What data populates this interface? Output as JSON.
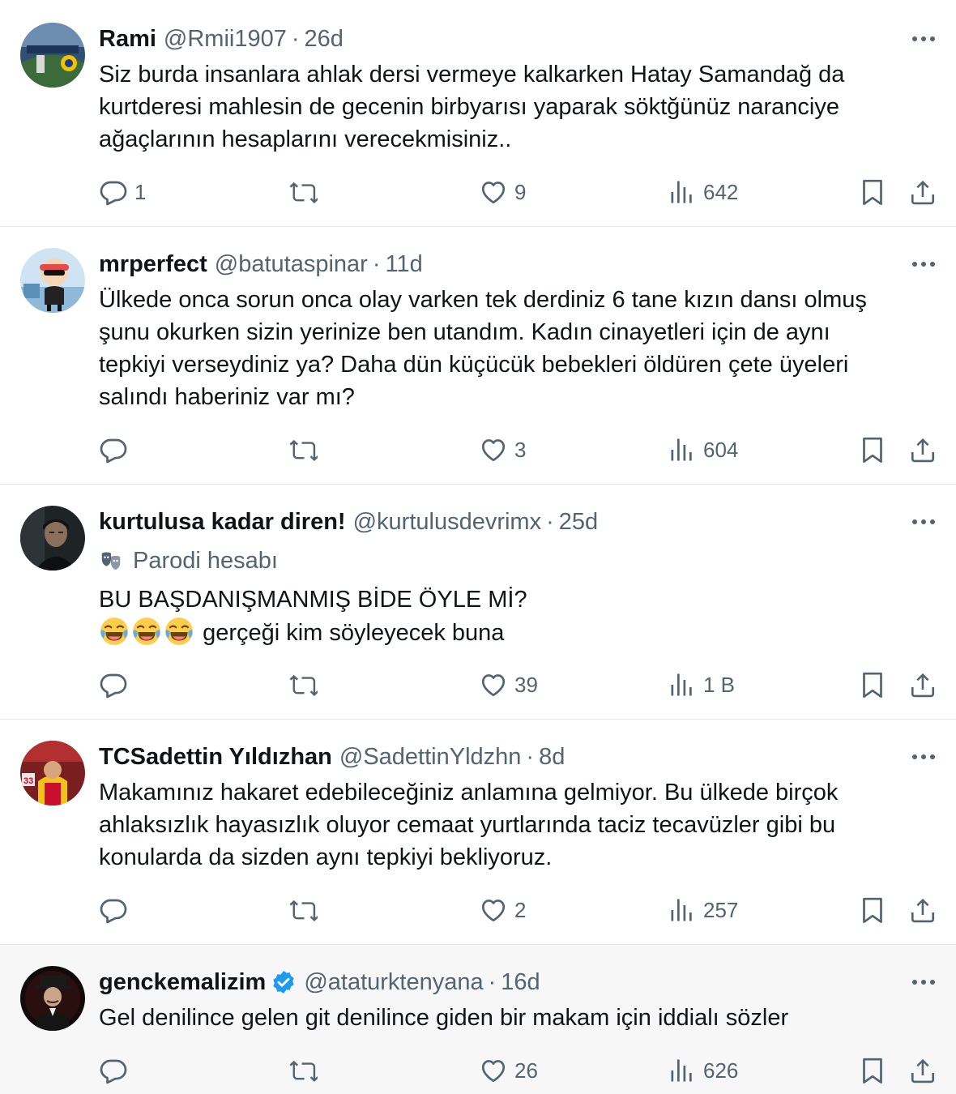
{
  "tweets": [
    {
      "name": "Rami",
      "handle": "@Rmii1907",
      "time": "26d",
      "text": [
        "Siz burda insanlara ahlak dersi vermeye kalkarken Hatay Samandağ da",
        "kurtderesi mahlesin de gecenin birbyarısı yaparak söktğünüz naranciye",
        "ağaçlarının hesaplarını verecekmisiniz.."
      ],
      "replies": "1",
      "reposts": "",
      "likes": "9",
      "views": "642",
      "avatar": "stadium"
    },
    {
      "name": "mrperfect",
      "handle": "@batutaspinar",
      "time": "11d",
      "text": [
        "Ülkede onca sorun onca olay varken tek derdiniz 6 tane kızın dansı olmuş",
        "şunu okurken sizin yerinize ben utandım. Kadın cinayetleri için de aynı",
        "tepkiyi verseydiniz ya? Daha dün küçücük bebekleri öldüren çete üyeleri",
        "salındı haberiniz var mı?"
      ],
      "replies": "",
      "reposts": "",
      "likes": "3",
      "views": "604",
      "avatar": "cartoon"
    },
    {
      "name": "kurtulusa kadar diren!",
      "handle": "@kurtulusdevrimx",
      "time": "25d",
      "label": "Parodi hesabı",
      "text": [
        "BU BAŞDANIŞMANMIŞ BİDE ÖYLE Mİ?",
        "gerçeği kim söyleyecek buna"
      ],
      "emoji_count": 3,
      "replies": "",
      "reposts": "",
      "likes": "39",
      "views": "1 B",
      "avatar": "dark-portrait"
    },
    {
      "name": "TCSadettin Yıldızhan",
      "handle": "@SadettinYldzhn",
      "time": "8d",
      "text": [
        "Makamınız hakaret edebileceğiniz anlamına gelmiyor. Bu ülkede birçok",
        "ahlaksızlık hayasızlık oluyor cemaat yurtlarında taciz tecavüzler gibi bu",
        "konularda da sizden aynı tepkiyi bekliyoruz."
      ],
      "replies": "",
      "reposts": "",
      "likes": "2",
      "views": "257",
      "avatar": "football"
    },
    {
      "name": "genckemalizim",
      "handle": "@ataturktenyana",
      "time": "16d",
      "verified": true,
      "text": [
        "Gel denilince gelen git denilince giden bir makam için iddialı sözler"
      ],
      "replies": "",
      "reposts": "",
      "likes": "26",
      "views": "626",
      "avatar": "hat-portrait"
    }
  ],
  "colors": {
    "text": "#0f1419",
    "secondary": "#536471",
    "divider": "#e7e9ea",
    "verified": "#1d9bf0",
    "highlight_bg": "#f7f7f7"
  },
  "icons": [
    "reply-icon",
    "repost-icon",
    "like-icon",
    "views-icon",
    "bookmark-icon",
    "share-icon",
    "more-icon",
    "parody-mask-icon",
    "verified-badge-icon",
    "laughing-emoji"
  ]
}
